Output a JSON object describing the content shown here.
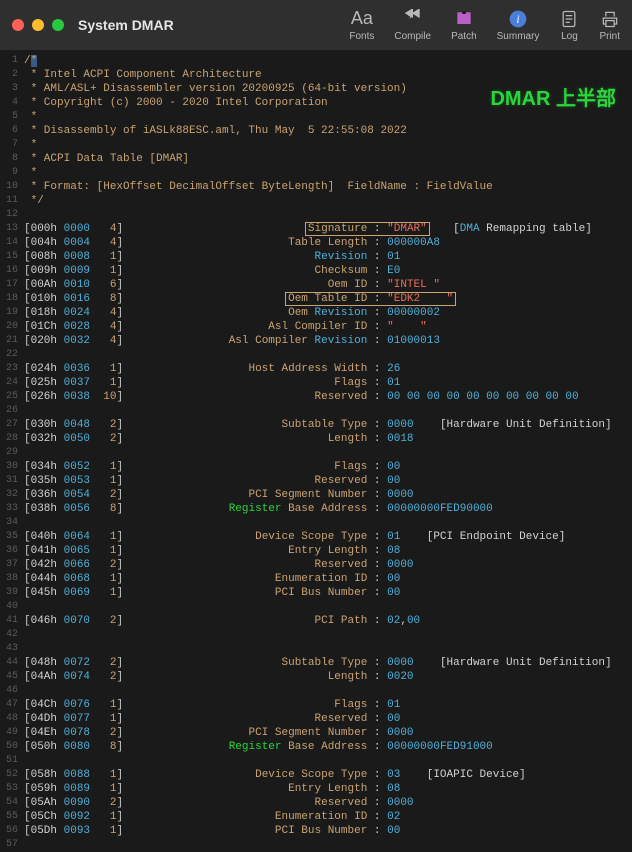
{
  "window": {
    "title": "System DMAR"
  },
  "toolbar": {
    "fonts": "Fonts",
    "compile": "Compile",
    "patch": "Patch",
    "summary": "Summary",
    "log": "Log",
    "print": "Print"
  },
  "watermark": "DMAR 上半部",
  "lines": [
    {
      "n": 1,
      "type": "cm",
      "t": "/*"
    },
    {
      "n": 2,
      "type": "cm",
      "t": " * Intel ACPI Component Architecture"
    },
    {
      "n": 3,
      "type": "cm",
      "t": " * AML/ASL+ Disassembler version 20200925 (64-bit version)"
    },
    {
      "n": 4,
      "type": "cm",
      "t": " * Copyright (c) 2000 - 2020 Intel Corporation"
    },
    {
      "n": 5,
      "type": "cm",
      "t": " *"
    },
    {
      "n": 6,
      "type": "cm",
      "t": " * Disassembly of iASLk88ESC.aml, Thu May  5 22:55:08 2022"
    },
    {
      "n": 7,
      "type": "cm",
      "t": " *"
    },
    {
      "n": 8,
      "type": "cm",
      "t": " * ACPI Data Table [DMAR]"
    },
    {
      "n": 9,
      "type": "cm",
      "t": " *"
    },
    {
      "n": 10,
      "type": "cm",
      "t": " * Format: [HexOffset DecimalOffset ByteLength]  FieldName : FieldValue"
    },
    {
      "n": 11,
      "type": "cm",
      "t": " */"
    },
    {
      "n": 12,
      "type": "blank"
    },
    {
      "n": 13,
      "type": "fld",
      "hex": "000h",
      "dec": "0000",
      "len": "4",
      "lbl": "Signature",
      "val": "\"DMAR\"",
      "vk": "str",
      "hl": true,
      "note": "[DMA Remapping table]",
      "noteHi": "DMA"
    },
    {
      "n": 14,
      "type": "fld",
      "hex": "004h",
      "dec": "0004",
      "len": "4",
      "lbl": "Table Length",
      "val": "000000A8",
      "vk": "num"
    },
    {
      "n": 15,
      "type": "fld",
      "hex": "008h",
      "dec": "0008",
      "len": "1",
      "lbl": "Revision",
      "lblHi": true,
      "val": "01",
      "vk": "num"
    },
    {
      "n": 16,
      "type": "fld",
      "hex": "009h",
      "dec": "0009",
      "len": "1",
      "lbl": "Checksum",
      "val": "E0",
      "vk": "num"
    },
    {
      "n": 17,
      "type": "fld",
      "hex": "00Ah",
      "dec": "0010",
      "len": "6",
      "lbl": "Oem ID",
      "val": "\"INTEL \"",
      "vk": "str"
    },
    {
      "n": 18,
      "type": "fld",
      "hex": "010h",
      "dec": "0016",
      "len": "8",
      "lbl": "Oem Table ID",
      "val": "\"EDK2    \"",
      "vk": "str",
      "hl": true
    },
    {
      "n": 19,
      "type": "fld",
      "hex": "018h",
      "dec": "0024",
      "len": "4",
      "lbl": "Oem Revision",
      "lblPre": "Oem ",
      "lblHi": true,
      "val": "00000002",
      "vk": "num"
    },
    {
      "n": 20,
      "type": "fld",
      "hex": "01Ch",
      "dec": "0028",
      "len": "4",
      "lbl": "Asl Compiler ID",
      "val": "\"    \"",
      "vk": "str"
    },
    {
      "n": 21,
      "type": "fld",
      "hex": "020h",
      "dec": "0032",
      "len": "4",
      "lbl": "Asl Compiler Revision",
      "lblPre": "Asl Compiler ",
      "lblHi": true,
      "val": "01000013",
      "vk": "num"
    },
    {
      "n": 22,
      "type": "blank"
    },
    {
      "n": 23,
      "type": "fld",
      "hex": "024h",
      "dec": "0036",
      "len": "1",
      "lbl": "Host Address Width",
      "val": "26",
      "vk": "num"
    },
    {
      "n": 24,
      "type": "fld",
      "hex": "025h",
      "dec": "0037",
      "len": "1",
      "lbl": "Flags",
      "val": "01",
      "vk": "num"
    },
    {
      "n": 25,
      "type": "fld",
      "hex": "026h",
      "dec": "0038",
      "len": "10",
      "lbl": "Reserved",
      "val": "00 00 00 00 00 00 00 00 00 00",
      "vk": "num"
    },
    {
      "n": 26,
      "type": "blank"
    },
    {
      "n": 27,
      "type": "fld",
      "hex": "030h",
      "dec": "0048",
      "len": "2",
      "lbl": "Subtable Type",
      "val": "0000",
      "vk": "num",
      "note": "[Hardware Unit Definition]"
    },
    {
      "n": 28,
      "type": "fld",
      "hex": "032h",
      "dec": "0050",
      "len": "2",
      "lbl": "Length",
      "val": "0018",
      "vk": "num"
    },
    {
      "n": 29,
      "type": "blank"
    },
    {
      "n": 30,
      "type": "fld",
      "hex": "034h",
      "dec": "0052",
      "len": "1",
      "lbl": "Flags",
      "val": "00",
      "vk": "num"
    },
    {
      "n": 31,
      "type": "fld",
      "hex": "035h",
      "dec": "0053",
      "len": "1",
      "lbl": "Reserved",
      "val": "00",
      "vk": "num"
    },
    {
      "n": 32,
      "type": "fld",
      "hex": "036h",
      "dec": "0054",
      "len": "2",
      "lbl": "PCI Segment Number",
      "val": "0000",
      "vk": "num"
    },
    {
      "n": 33,
      "type": "fld",
      "hex": "038h",
      "dec": "0056",
      "len": "8",
      "lbl": "Register Base Address",
      "reg": true,
      "val": "00000000FED90000",
      "vk": "num"
    },
    {
      "n": 34,
      "type": "blank"
    },
    {
      "n": 35,
      "type": "fld",
      "hex": "040h",
      "dec": "0064",
      "len": "1",
      "lbl": "Device Scope Type",
      "val": "01",
      "vk": "num",
      "note": "[PCI Endpoint Device]"
    },
    {
      "n": 36,
      "type": "fld",
      "hex": "041h",
      "dec": "0065",
      "len": "1",
      "lbl": "Entry Length",
      "val": "08",
      "vk": "num"
    },
    {
      "n": 37,
      "type": "fld",
      "hex": "042h",
      "dec": "0066",
      "len": "2",
      "lbl": "Reserved",
      "val": "0000",
      "vk": "num"
    },
    {
      "n": 38,
      "type": "fld",
      "hex": "044h",
      "dec": "0068",
      "len": "1",
      "lbl": "Enumeration ID",
      "val": "00",
      "vk": "num"
    },
    {
      "n": 39,
      "type": "fld",
      "hex": "045h",
      "dec": "0069",
      "len": "1",
      "lbl": "PCI Bus Number",
      "val": "00",
      "vk": "num"
    },
    {
      "n": 40,
      "type": "blank"
    },
    {
      "n": 41,
      "type": "fld",
      "hex": "046h",
      "dec": "0070",
      "len": "2",
      "lbl": "PCI Path",
      "val": "02,00",
      "vk": "num"
    },
    {
      "n": 42,
      "type": "blank"
    },
    {
      "n": 43,
      "type": "blank"
    },
    {
      "n": 44,
      "type": "fld",
      "hex": "048h",
      "dec": "0072",
      "len": "2",
      "lbl": "Subtable Type",
      "val": "0000",
      "vk": "num",
      "note": "[Hardware Unit Definition]"
    },
    {
      "n": 45,
      "type": "fld",
      "hex": "04Ah",
      "dec": "0074",
      "len": "2",
      "lbl": "Length",
      "val": "0020",
      "vk": "num"
    },
    {
      "n": 46,
      "type": "blank"
    },
    {
      "n": 47,
      "type": "fld",
      "hex": "04Ch",
      "dec": "0076",
      "len": "1",
      "lbl": "Flags",
      "val": "01",
      "vk": "num"
    },
    {
      "n": 48,
      "type": "fld",
      "hex": "04Dh",
      "dec": "0077",
      "len": "1",
      "lbl": "Reserved",
      "val": "00",
      "vk": "num"
    },
    {
      "n": 49,
      "type": "fld",
      "hex": "04Eh",
      "dec": "0078",
      "len": "2",
      "lbl": "PCI Segment Number",
      "val": "0000",
      "vk": "num"
    },
    {
      "n": 50,
      "type": "fld",
      "hex": "050h",
      "dec": "0080",
      "len": "8",
      "lbl": "Register Base Address",
      "reg": true,
      "val": "00000000FED91000",
      "vk": "num"
    },
    {
      "n": 51,
      "type": "blank"
    },
    {
      "n": 52,
      "type": "fld",
      "hex": "058h",
      "dec": "0088",
      "len": "1",
      "lbl": "Device Scope Type",
      "val": "03",
      "vk": "num",
      "note": "[IOAPIC Device]"
    },
    {
      "n": 53,
      "type": "fld",
      "hex": "059h",
      "dec": "0089",
      "len": "1",
      "lbl": "Entry Length",
      "val": "08",
      "vk": "num"
    },
    {
      "n": 54,
      "type": "fld",
      "hex": "05Ah",
      "dec": "0090",
      "len": "2",
      "lbl": "Reserved",
      "val": "0000",
      "vk": "num"
    },
    {
      "n": 55,
      "type": "fld",
      "hex": "05Ch",
      "dec": "0092",
      "len": "1",
      "lbl": "Enumeration ID",
      "val": "02",
      "vk": "num"
    },
    {
      "n": 56,
      "type": "fld",
      "hex": "05Dh",
      "dec": "0093",
      "len": "1",
      "lbl": "PCI Bus Number",
      "val": "00",
      "vk": "num"
    },
    {
      "n": 57,
      "type": "blank"
    }
  ]
}
